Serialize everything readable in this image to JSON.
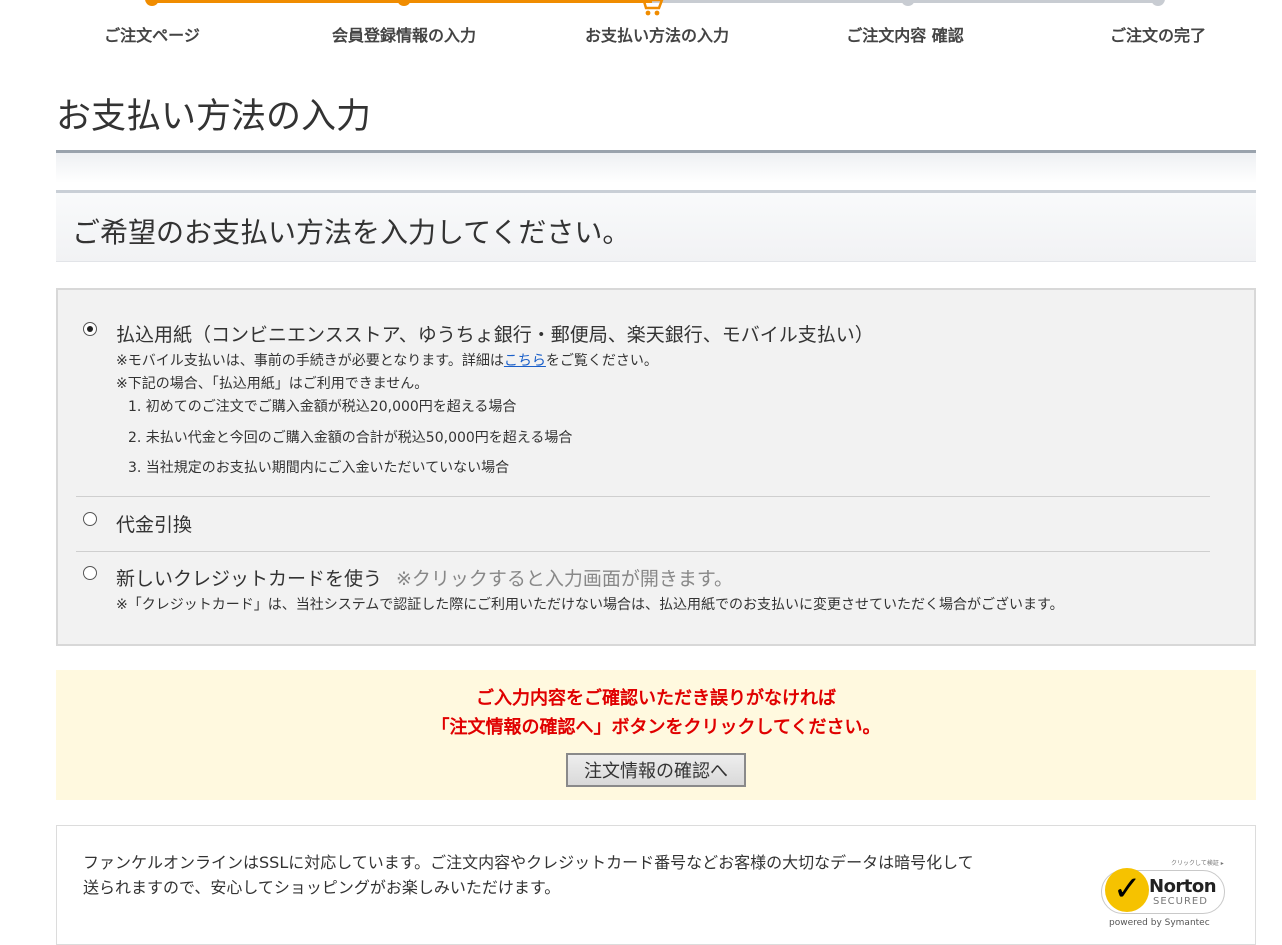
{
  "steps": [
    {
      "label": "ご注文ページ",
      "state": "done"
    },
    {
      "label": "会員登録情報の入力",
      "state": "done"
    },
    {
      "label": "お支払い方法の入力",
      "state": "current"
    },
    {
      "label": "ご注文内容 確認",
      "state": "todo"
    },
    {
      "label": "ご注文の完了",
      "state": "todo"
    }
  ],
  "page_title": "お支払い方法の入力",
  "section_heading": "ご希望のお支払い方法を入力してください。",
  "payment": {
    "option1": {
      "label": "払込用紙（コンビニエンスストア、ゆうちょ銀行・郵便局、楽天銀行、モバイル支払い）",
      "note1_pre": "※モバイル支払いは、事前の手続きが必要となります。詳細は",
      "note1_link": "こちら",
      "note1_post": "をご覧ください。",
      "note2": "※下記の場合、「払込用紙」はご利用できません。",
      "conditions": [
        "1.  初めてのご注文でご購入金額が税込20,000円を超える場合",
        "2.  未払い代金と今回のご購入金額の合計が税込50,000円を超える場合",
        "3.  当社規定のお支払い期間内にご入金いただいていない場合"
      ],
      "selected": true
    },
    "option2": {
      "label": "代金引換",
      "selected": false
    },
    "option3": {
      "label": "新しいクレジットカードを使う",
      "hint": "※クリックすると入力画面が開きます。",
      "note": "※「クレジットカード」は、当社システムで認証した際にご利用いただけない場合は、払込用紙でのお支払いに変更させていただく場合がございます。",
      "selected": false
    }
  },
  "confirm": {
    "line1": "ご入力内容をご確認いただき誤りがなければ",
    "line2": "「注文情報の確認へ」ボタンをクリックしてください。",
    "button": "注文情報の確認へ"
  },
  "ssl": {
    "line1": "ファンケルオンラインはSSLに対応しています。ご注文内容やクレジットカード番号などお客様の大切なデータは暗号化して",
    "line2": "送られますので、安心してショッピングがお楽しみいただけます。"
  },
  "norton": {
    "name": "Norton",
    "secured": "SECURED",
    "powered": "powered by Symantec",
    "small_top": "クリックして検証 ▸"
  },
  "colors": {
    "progress_done": "#f08c00",
    "progress_todo": "#c8ccd2",
    "confirm_text": "#e00000",
    "confirm_bg": "#fff9df",
    "link": "#1a5fc9"
  }
}
